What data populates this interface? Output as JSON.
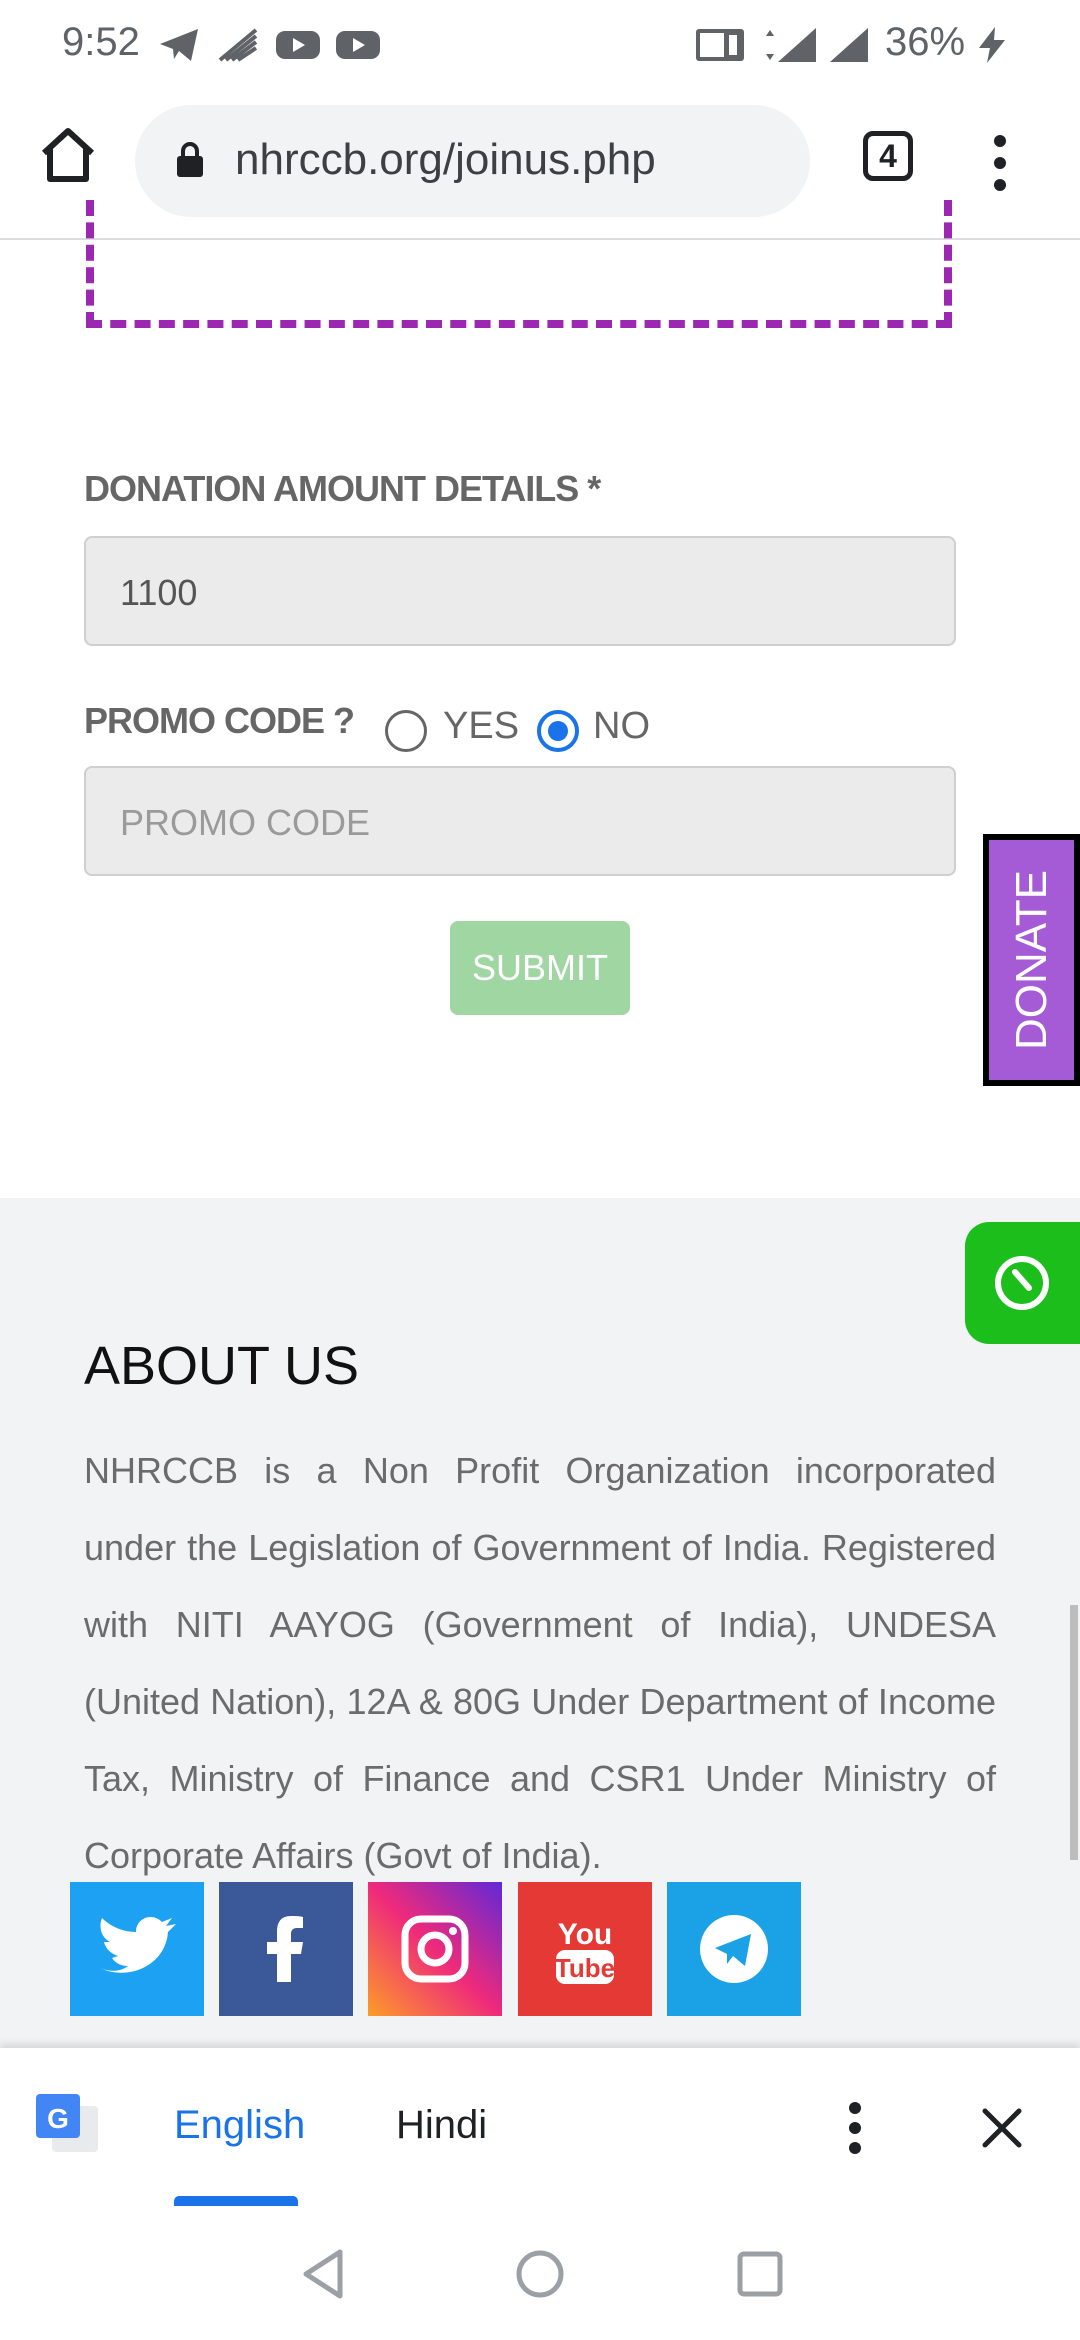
{
  "status_bar": {
    "time": "9:52",
    "battery": "36%",
    "icons": [
      "telegram-icon",
      "broadcast-icon",
      "youtube-icon",
      "youtube-icon",
      "volte-icon",
      "signal-4g-icon",
      "signal-icon",
      "charging-icon"
    ]
  },
  "browser": {
    "url": "nhrccb.org/joinus.php",
    "tab_count": "4"
  },
  "form": {
    "donation_label": "DONATION AMOUNT DETAILS *",
    "donation_value": "1100",
    "promo_label": "PROMO CODE ?",
    "promo_yes": "YES",
    "promo_no": "NO",
    "promo_selected": "NO",
    "promo_placeholder": "PROMO CODE",
    "submit": "SUBMIT"
  },
  "donate_tab": "DONATE",
  "footer": {
    "about_title": "ABOUT US",
    "about_text": "NHRCCB is a Non Profit Organization incorporated under the Legislation of Government of India. Registered with NITI AAYOG (Government of India), UNDESA (United Nation), 12A & 80G Under Department of Income Tax, Ministry of Finance and CSR1 Under Ministry of Corporate Affairs (Govt of India).",
    "social": [
      "twitter-icon",
      "facebook-icon",
      "instagram-icon",
      "youtube-icon",
      "telegram-icon"
    ],
    "youtube_logo_top": "You",
    "youtube_logo_bottom": "Tube"
  },
  "translate_bar": {
    "languages": [
      "English",
      "Hindi"
    ],
    "selected": "English"
  },
  "colors": {
    "accent": "#1a73e8",
    "donate": "#a55bd6",
    "submit": "#9fd6a2",
    "chat": "#1cbe1c",
    "dashed_border": "#9c27b0"
  }
}
